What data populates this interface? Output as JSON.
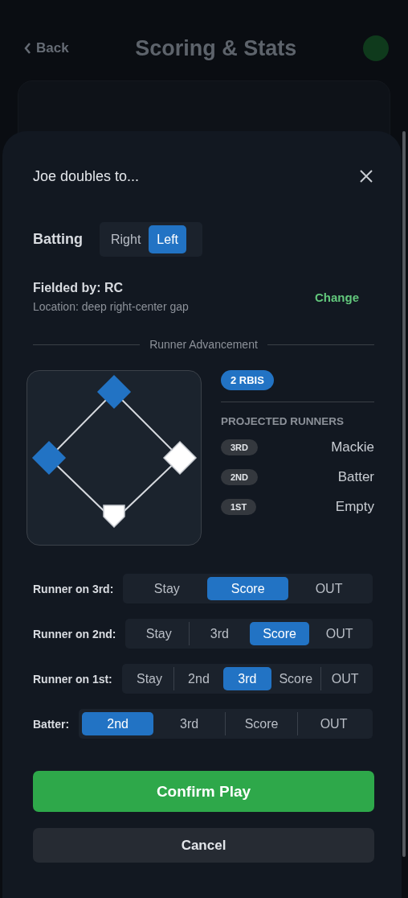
{
  "background": {
    "back_label": "Back",
    "title": "Scoring & Stats"
  },
  "sheet": {
    "title": "Joe doubles to...",
    "batting": {
      "label": "Batting",
      "options": [
        {
          "label": "Right",
          "selected": false
        },
        {
          "label": "Left",
          "selected": true
        }
      ]
    },
    "fielded": {
      "title": "Fielded by: RC",
      "location": "Location: deep right-center gap",
      "action": "Change"
    },
    "section_label": "Runner Advancement",
    "bases": [
      {
        "occupied": false
      },
      {
        "occupied": true
      },
      {
        "occupied": true
      }
    ],
    "rbi_badge": "2 RBIS",
    "projected_title": "PROJECTED RUNNERS",
    "projected": [
      {
        "base": "3RD",
        "runner": "Mackie"
      },
      {
        "base": "2ND",
        "runner": "Batter"
      },
      {
        "base": "1ST",
        "runner": "Empty"
      }
    ],
    "advancement": [
      {
        "label": "Runner on 3rd:",
        "options": [
          {
            "label": "Stay",
            "selected": false
          },
          {
            "label": "Score",
            "selected": true
          },
          {
            "label": "OUT",
            "selected": false
          }
        ]
      },
      {
        "label": "Runner on 2nd:",
        "options": [
          {
            "label": "Stay",
            "selected": false
          },
          {
            "label": "3rd",
            "selected": false
          },
          {
            "label": "Score",
            "selected": true
          },
          {
            "label": "OUT",
            "selected": false
          }
        ]
      },
      {
        "label": "Runner on 1st:",
        "options": [
          {
            "label": "Stay",
            "selected": false
          },
          {
            "label": "2nd",
            "selected": false
          },
          {
            "label": "3rd",
            "selected": true
          },
          {
            "label": "Score",
            "selected": false
          },
          {
            "label": "OUT",
            "selected": false
          }
        ]
      },
      {
        "label": "Batter:",
        "options": [
          {
            "label": "2nd",
            "selected": true
          },
          {
            "label": "3rd",
            "selected": false
          },
          {
            "label": "Score",
            "selected": false
          },
          {
            "label": "OUT",
            "selected": false
          }
        ]
      }
    ],
    "confirm": "Confirm Play",
    "cancel": "Cancel"
  }
}
